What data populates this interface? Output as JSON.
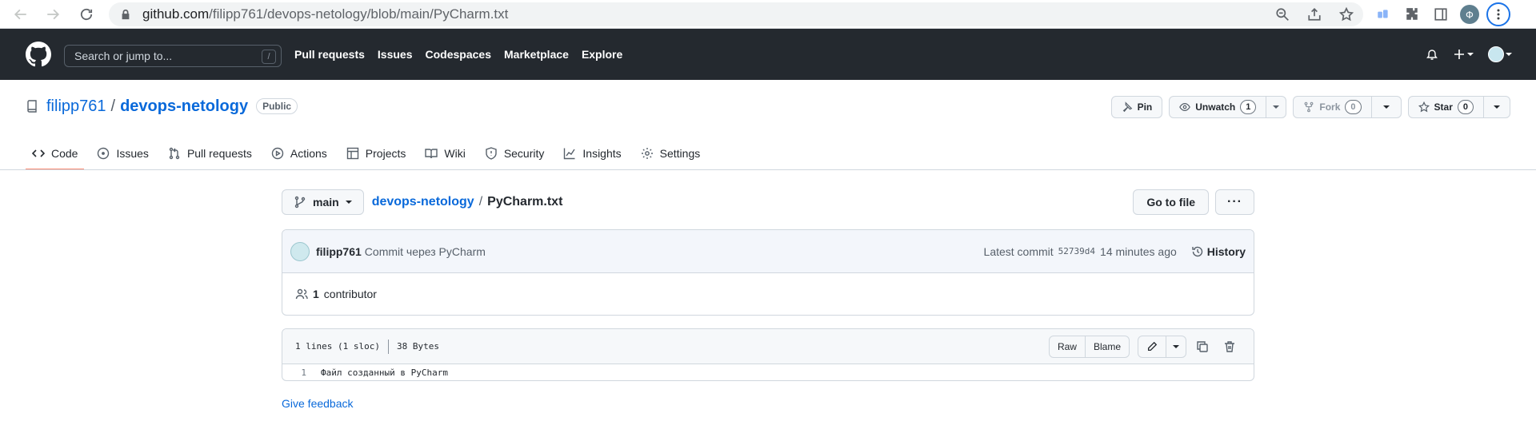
{
  "browser": {
    "url_domain": "github.com",
    "url_path": "/filipp761/devops-netology/blob/main/PyCharm.txt",
    "profile_initial": "Ф"
  },
  "header": {
    "search_placeholder": "Search or jump to...",
    "search_shortcut": "/",
    "nav": [
      "Pull requests",
      "Issues",
      "Codespaces",
      "Marketplace",
      "Explore"
    ]
  },
  "repo": {
    "owner": "filipp761",
    "separator": "/",
    "name": "devops-netology",
    "visibility": "Public",
    "pin_label": "Pin",
    "unwatch_label": "Unwatch",
    "unwatch_count": "1",
    "fork_label": "Fork",
    "fork_count": "0",
    "star_label": "Star",
    "star_count": "0"
  },
  "tabs": [
    {
      "label": "Code",
      "icon": "code-icon"
    },
    {
      "label": "Issues",
      "icon": "issue-icon"
    },
    {
      "label": "Pull requests",
      "icon": "pull-request-icon"
    },
    {
      "label": "Actions",
      "icon": "play-icon"
    },
    {
      "label": "Projects",
      "icon": "table-icon"
    },
    {
      "label": "Wiki",
      "icon": "book-icon"
    },
    {
      "label": "Security",
      "icon": "shield-icon"
    },
    {
      "label": "Insights",
      "icon": "graph-icon"
    },
    {
      "label": "Settings",
      "icon": "gear-icon"
    }
  ],
  "file_view": {
    "branch": "main",
    "breadcrumb_repo": "devops-netology",
    "breadcrumb_sep": "/",
    "file_name": "PyCharm.txt",
    "go_to_file": "Go to file",
    "more_label": "···",
    "commit": {
      "author": "filipp761",
      "message": "Commit через PyCharm",
      "latest_label": "Latest commit",
      "sha": "52739d4",
      "time": "14 minutes ago",
      "history": "History"
    },
    "contributors_count": "1",
    "contributors_label": "contributor",
    "lines_info": "1 lines (1 sloc)",
    "size_info": "38 Bytes",
    "raw_label": "Raw",
    "blame_label": "Blame",
    "code_lines": [
      {
        "num": "1",
        "text": "Файл созданный в PyCharm"
      }
    ],
    "feedback": "Give feedback"
  }
}
